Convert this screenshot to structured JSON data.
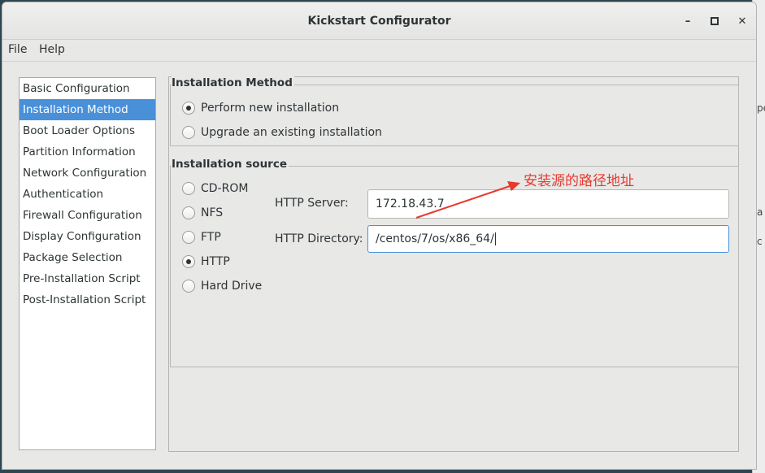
{
  "window": {
    "title": "Kickstart Configurator",
    "minimize_glyph": "–",
    "maximize_glyph": "▪",
    "close_glyph": "✕"
  },
  "menubar": {
    "items": [
      {
        "label": "File"
      },
      {
        "label": "Help"
      }
    ]
  },
  "sidebar": {
    "selected_index": 1,
    "items": [
      {
        "label": "Basic Configuration"
      },
      {
        "label": "Installation Method"
      },
      {
        "label": "Boot Loader Options"
      },
      {
        "label": "Partition Information"
      },
      {
        "label": "Network Configuration"
      },
      {
        "label": "Authentication"
      },
      {
        "label": "Firewall Configuration"
      },
      {
        "label": "Display Configuration"
      },
      {
        "label": "Package Selection"
      },
      {
        "label": "Pre-Installation Script"
      },
      {
        "label": "Post-Installation Script"
      }
    ]
  },
  "installation_method": {
    "heading": "Installation Method",
    "options": [
      {
        "label": "Perform new installation",
        "checked": true
      },
      {
        "label": "Upgrade an existing installation",
        "checked": false
      }
    ]
  },
  "installation_source": {
    "heading": "Installation source",
    "options": [
      {
        "label": "CD-ROM",
        "checked": false
      },
      {
        "label": "NFS",
        "checked": false
      },
      {
        "label": "FTP",
        "checked": false
      },
      {
        "label": "HTTP",
        "checked": true
      },
      {
        "label": "Hard Drive",
        "checked": false
      }
    ],
    "http_server": {
      "label": "HTTP Server:",
      "value": "172.18.43.7"
    },
    "http_directory": {
      "label": "HTTP Directory:",
      "value": "/centos/7/os/x86_64/"
    }
  },
  "annotation": {
    "text": "安装源的路径地址",
    "color": "#e8392d"
  },
  "background_window": {
    "glyphs": [
      "pe",
      "a",
      "c"
    ]
  },
  "colors": {
    "accent": "#4a90d9",
    "annotation": "#e8392d",
    "desktop": "#2c4752"
  }
}
